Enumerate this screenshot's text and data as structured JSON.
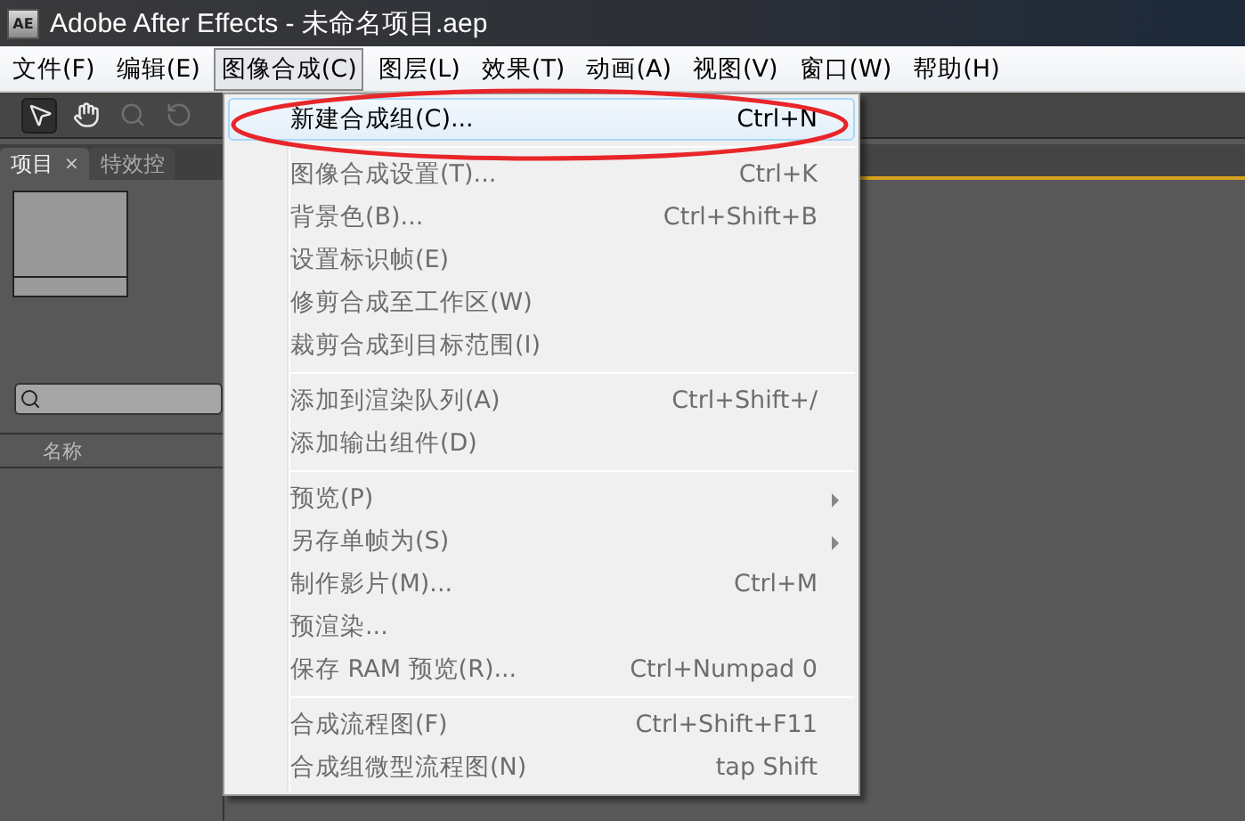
{
  "window": {
    "title": "Adobe After Effects - 未命名项目.aep",
    "app_badge": "AE"
  },
  "menubar": [
    {
      "label": "文件(F)",
      "selected": false
    },
    {
      "label": "编辑(E)",
      "selected": false
    },
    {
      "label": "图像合成(C)",
      "selected": true
    },
    {
      "label": "图层(L)",
      "selected": false
    },
    {
      "label": "效果(T)",
      "selected": false
    },
    {
      "label": "动画(A)",
      "selected": false
    },
    {
      "label": "视图(V)",
      "selected": false
    },
    {
      "label": "窗口(W)",
      "selected": false
    },
    {
      "label": "帮助(H)",
      "selected": false
    }
  ],
  "toolbar": [
    {
      "kind": "select",
      "selected": true,
      "disabled": false
    },
    {
      "kind": "hand",
      "selected": false,
      "disabled": false
    },
    {
      "kind": "zoom",
      "selected": false,
      "disabled": true
    },
    {
      "kind": "rotate",
      "selected": false,
      "disabled": true
    }
  ],
  "panel": {
    "tabs": [
      {
        "label": "项目",
        "close": "×",
        "selected": true
      },
      {
        "label": "特效控",
        "selected": false
      }
    ],
    "column": "名称"
  },
  "menu": [
    {
      "kind": "item",
      "label": "新建合成组(C)...",
      "shortcut": "Ctrl+N",
      "disabled": false,
      "selected": true,
      "submenu": false
    },
    {
      "kind": "separator"
    },
    {
      "kind": "item",
      "label": "图像合成设置(T)...",
      "shortcut": "Ctrl+K",
      "disabled": true,
      "selected": false,
      "submenu": false
    },
    {
      "kind": "item",
      "label": "背景色(B)...",
      "shortcut": "Ctrl+Shift+B",
      "disabled": true,
      "selected": false,
      "submenu": false
    },
    {
      "kind": "item",
      "label": "设置标识帧(E)",
      "disabled": true,
      "selected": false,
      "submenu": false
    },
    {
      "kind": "item",
      "label": "修剪合成至工作区(W)",
      "disabled": true,
      "selected": false,
      "submenu": false
    },
    {
      "kind": "item",
      "label": "裁剪合成到目标范围(I)",
      "disabled": true,
      "selected": false,
      "submenu": false
    },
    {
      "kind": "separator"
    },
    {
      "kind": "item",
      "label": "添加到渲染队列(A)",
      "shortcut": "Ctrl+Shift+/",
      "disabled": true,
      "selected": false,
      "submenu": false
    },
    {
      "kind": "item",
      "label": "添加输出组件(D)",
      "disabled": true,
      "selected": false,
      "submenu": false
    },
    {
      "kind": "separator"
    },
    {
      "kind": "item",
      "label": "预览(P)",
      "disabled": true,
      "selected": false,
      "submenu": true
    },
    {
      "kind": "item",
      "label": "另存单帧为(S)",
      "disabled": true,
      "selected": false,
      "submenu": true
    },
    {
      "kind": "item",
      "label": "制作影片(M)...",
      "shortcut": "Ctrl+M",
      "disabled": true,
      "selected": false,
      "submenu": false
    },
    {
      "kind": "item",
      "label": "预渲染...",
      "disabled": true,
      "selected": false,
      "submenu": false
    },
    {
      "kind": "item",
      "label": "保存 RAM 预览(R)...",
      "shortcut": "Ctrl+Numpad 0",
      "disabled": true,
      "selected": false,
      "submenu": false
    },
    {
      "kind": "separator"
    },
    {
      "kind": "item",
      "label": "合成流程图(F)",
      "shortcut": "Ctrl+Shift+F11",
      "disabled": true,
      "selected": false,
      "submenu": false
    },
    {
      "kind": "item",
      "label": "合成组微型流程图(N)",
      "shortcut": "tap Shift",
      "disabled": true,
      "selected": false,
      "submenu": false
    }
  ]
}
